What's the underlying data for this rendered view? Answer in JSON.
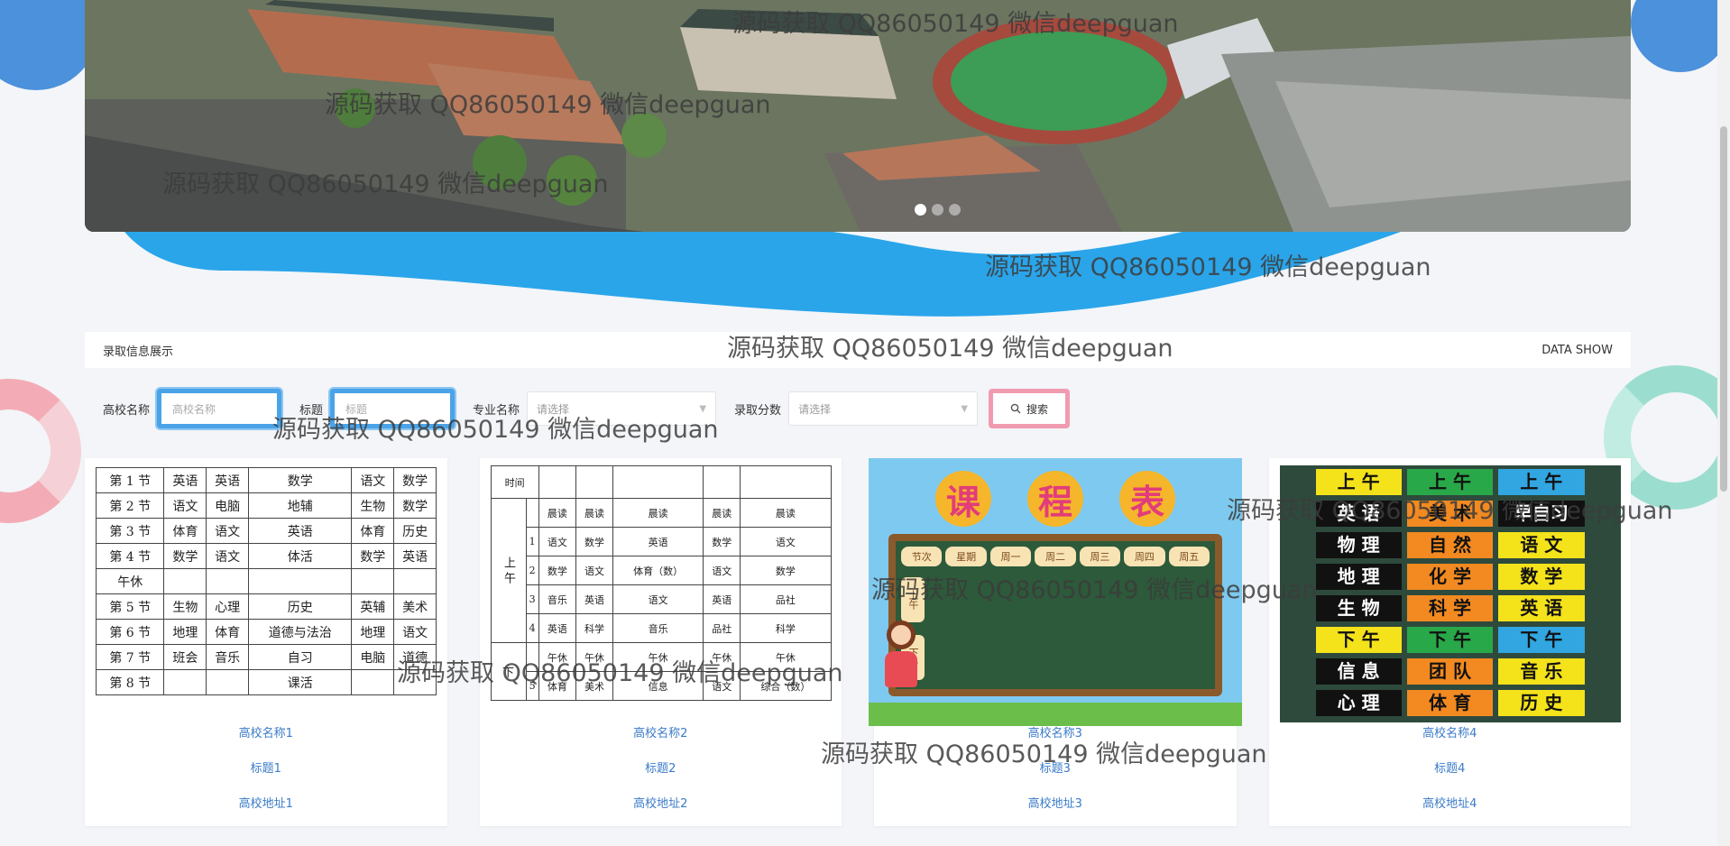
{
  "banner": {
    "dots": 3,
    "active_dot": 1
  },
  "panel": {
    "title": "录取信息展示",
    "right_label": "DATA SHOW"
  },
  "search": {
    "label_school": "高校名称",
    "placeholder_school": "高校名称",
    "label_title": "标题",
    "placeholder_title": "标题",
    "label_major": "专业名称",
    "major_value": "请选择",
    "label_score": "录取分数",
    "score_value": "请选择",
    "button_label": "搜索"
  },
  "cards": [
    {
      "school": "高校名称1",
      "title": "标题1",
      "address": "高校地址1"
    },
    {
      "school": "高校名称2",
      "title": "标题2",
      "address": "高校地址2"
    },
    {
      "school": "高校名称3",
      "title": "标题3",
      "address": "高校地址3"
    },
    {
      "school": "高校名称4",
      "title": "标题4",
      "address": "高校地址4"
    }
  ],
  "card1_table": {
    "rows": [
      [
        "第 1 节",
        "英语",
        "英语",
        "数学",
        "语文",
        "数学"
      ],
      [
        "第 2 节",
        "语文",
        "电脑",
        "地辅",
        "生物",
        "数学"
      ],
      [
        "第 3 节",
        "体育",
        "语文",
        "英语",
        "体育",
        "历史"
      ],
      [
        "第 4 节",
        "数学",
        "语文",
        "体活",
        "数学",
        "英语"
      ],
      [
        "午休",
        "",
        "",
        "",
        "",
        ""
      ],
      [
        "第 5 节",
        "生物",
        "心理",
        "历史",
        "英辅",
        "美术"
      ],
      [
        "第 6 节",
        "地理",
        "体育",
        "道德与法治",
        "地理",
        "语文"
      ],
      [
        "第 7 节",
        "班会",
        "音乐",
        "自习",
        "电脑",
        "道德"
      ],
      [
        "第 8 节",
        "",
        "",
        "课活",
        "",
        ""
      ]
    ]
  },
  "card2_table": {
    "header": "时间",
    "am": "上 午",
    "pm": "下",
    "rows": [
      [
        "",
        "晨读",
        "晨读",
        "晨读",
        "晨读",
        "晨读"
      ],
      [
        "1",
        "语文",
        "数学",
        "英语",
        "数学",
        "语文"
      ],
      [
        "2",
        "数学",
        "语文",
        "体育（数）",
        "语文",
        "数学"
      ],
      [
        "3",
        "音乐",
        "英语",
        "语文",
        "英语",
        "品社"
      ],
      [
        "4",
        "英语",
        "科学",
        "音乐",
        "品社",
        "科学"
      ],
      [
        "",
        "午休",
        "午休",
        "午休",
        "午休",
        "午休"
      ],
      [
        "5",
        "体育",
        "美术",
        "信息",
        "语文",
        "综合（数）"
      ]
    ]
  },
  "card3_board": {
    "title_chars": [
      "课",
      "程",
      "表"
    ],
    "header": [
      "节次",
      "星期",
      "周一",
      "周二",
      "周三",
      "周四",
      "周五"
    ],
    "am": "上午",
    "pm": "下午"
  },
  "card4_grid": {
    "rows": [
      [
        "上 午",
        "上 午",
        "上 午"
      ],
      [
        "英 语",
        "美 术",
        "早自习"
      ],
      [
        "物 理",
        "自 然",
        "语 文"
      ],
      [
        "地 理",
        "化 学",
        "数 学"
      ],
      [
        "生 物",
        "科 学",
        "英 语"
      ],
      [
        "下 午",
        "下 午",
        "下 午"
      ],
      [
        "信 息",
        "团 队",
        "音 乐"
      ],
      [
        "心 理",
        "体 育",
        "历 史"
      ]
    ]
  },
  "watermark": "源码获取 QQ86050149 微信deepguan",
  "colors": {
    "accent_blue": "#4aa3e8",
    "button_pink": "#f19bb0",
    "link_blue": "#3a7bc8"
  }
}
